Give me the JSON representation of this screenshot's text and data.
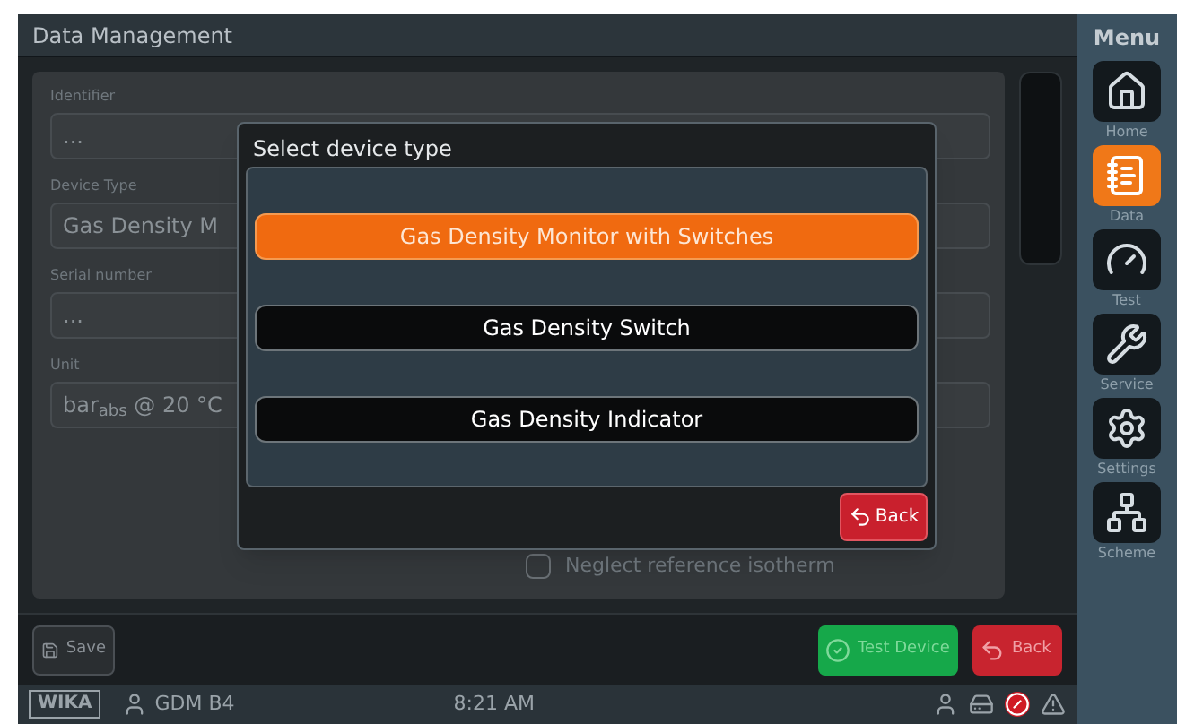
{
  "window": {
    "title": "Data Management"
  },
  "form": {
    "fields": [
      {
        "label": "Identifier",
        "value": "..."
      },
      {
        "label": "Device Type",
        "value": "Gas Density M"
      },
      {
        "label": "Serial number",
        "value": "..."
      },
      {
        "label": "Unit",
        "value": "bar$_{abs}$ @ 20 °C"
      }
    ],
    "options": [
      {
        "label": "Neglect reference isotherm",
        "checked": false
      }
    ]
  },
  "toolbar": {
    "buttons": [
      {
        "kind": "save",
        "label": "Save"
      },
      {
        "kind": "test",
        "label": "Test Device"
      },
      {
        "kind": "back",
        "label": "Back"
      }
    ]
  },
  "dialog": {
    "title": "Select device type",
    "options": [
      {
        "label": "Gas Density Monitor with Switches",
        "selected": true
      },
      {
        "label": "Gas Density Switch",
        "selected": false
      },
      {
        "label": "Gas Density Indicator",
        "selected": false
      }
    ],
    "back_button": "Back"
  },
  "menu": {
    "title": "Menu",
    "items": [
      {
        "kind": "home",
        "label": "Home",
        "selected": false
      },
      {
        "kind": "data",
        "label": "Data",
        "selected": true
      },
      {
        "kind": "test",
        "label": "Test",
        "selected": false
      },
      {
        "kind": "service",
        "label": "Service",
        "selected": false
      },
      {
        "kind": "settings",
        "label": "Settings",
        "selected": false
      },
      {
        "kind": "scheme",
        "label": "Scheme",
        "selected": false
      }
    ]
  },
  "status_bar": {
    "logo": "WIKA",
    "user": "GDM B4",
    "time": "8:21 AM"
  }
}
